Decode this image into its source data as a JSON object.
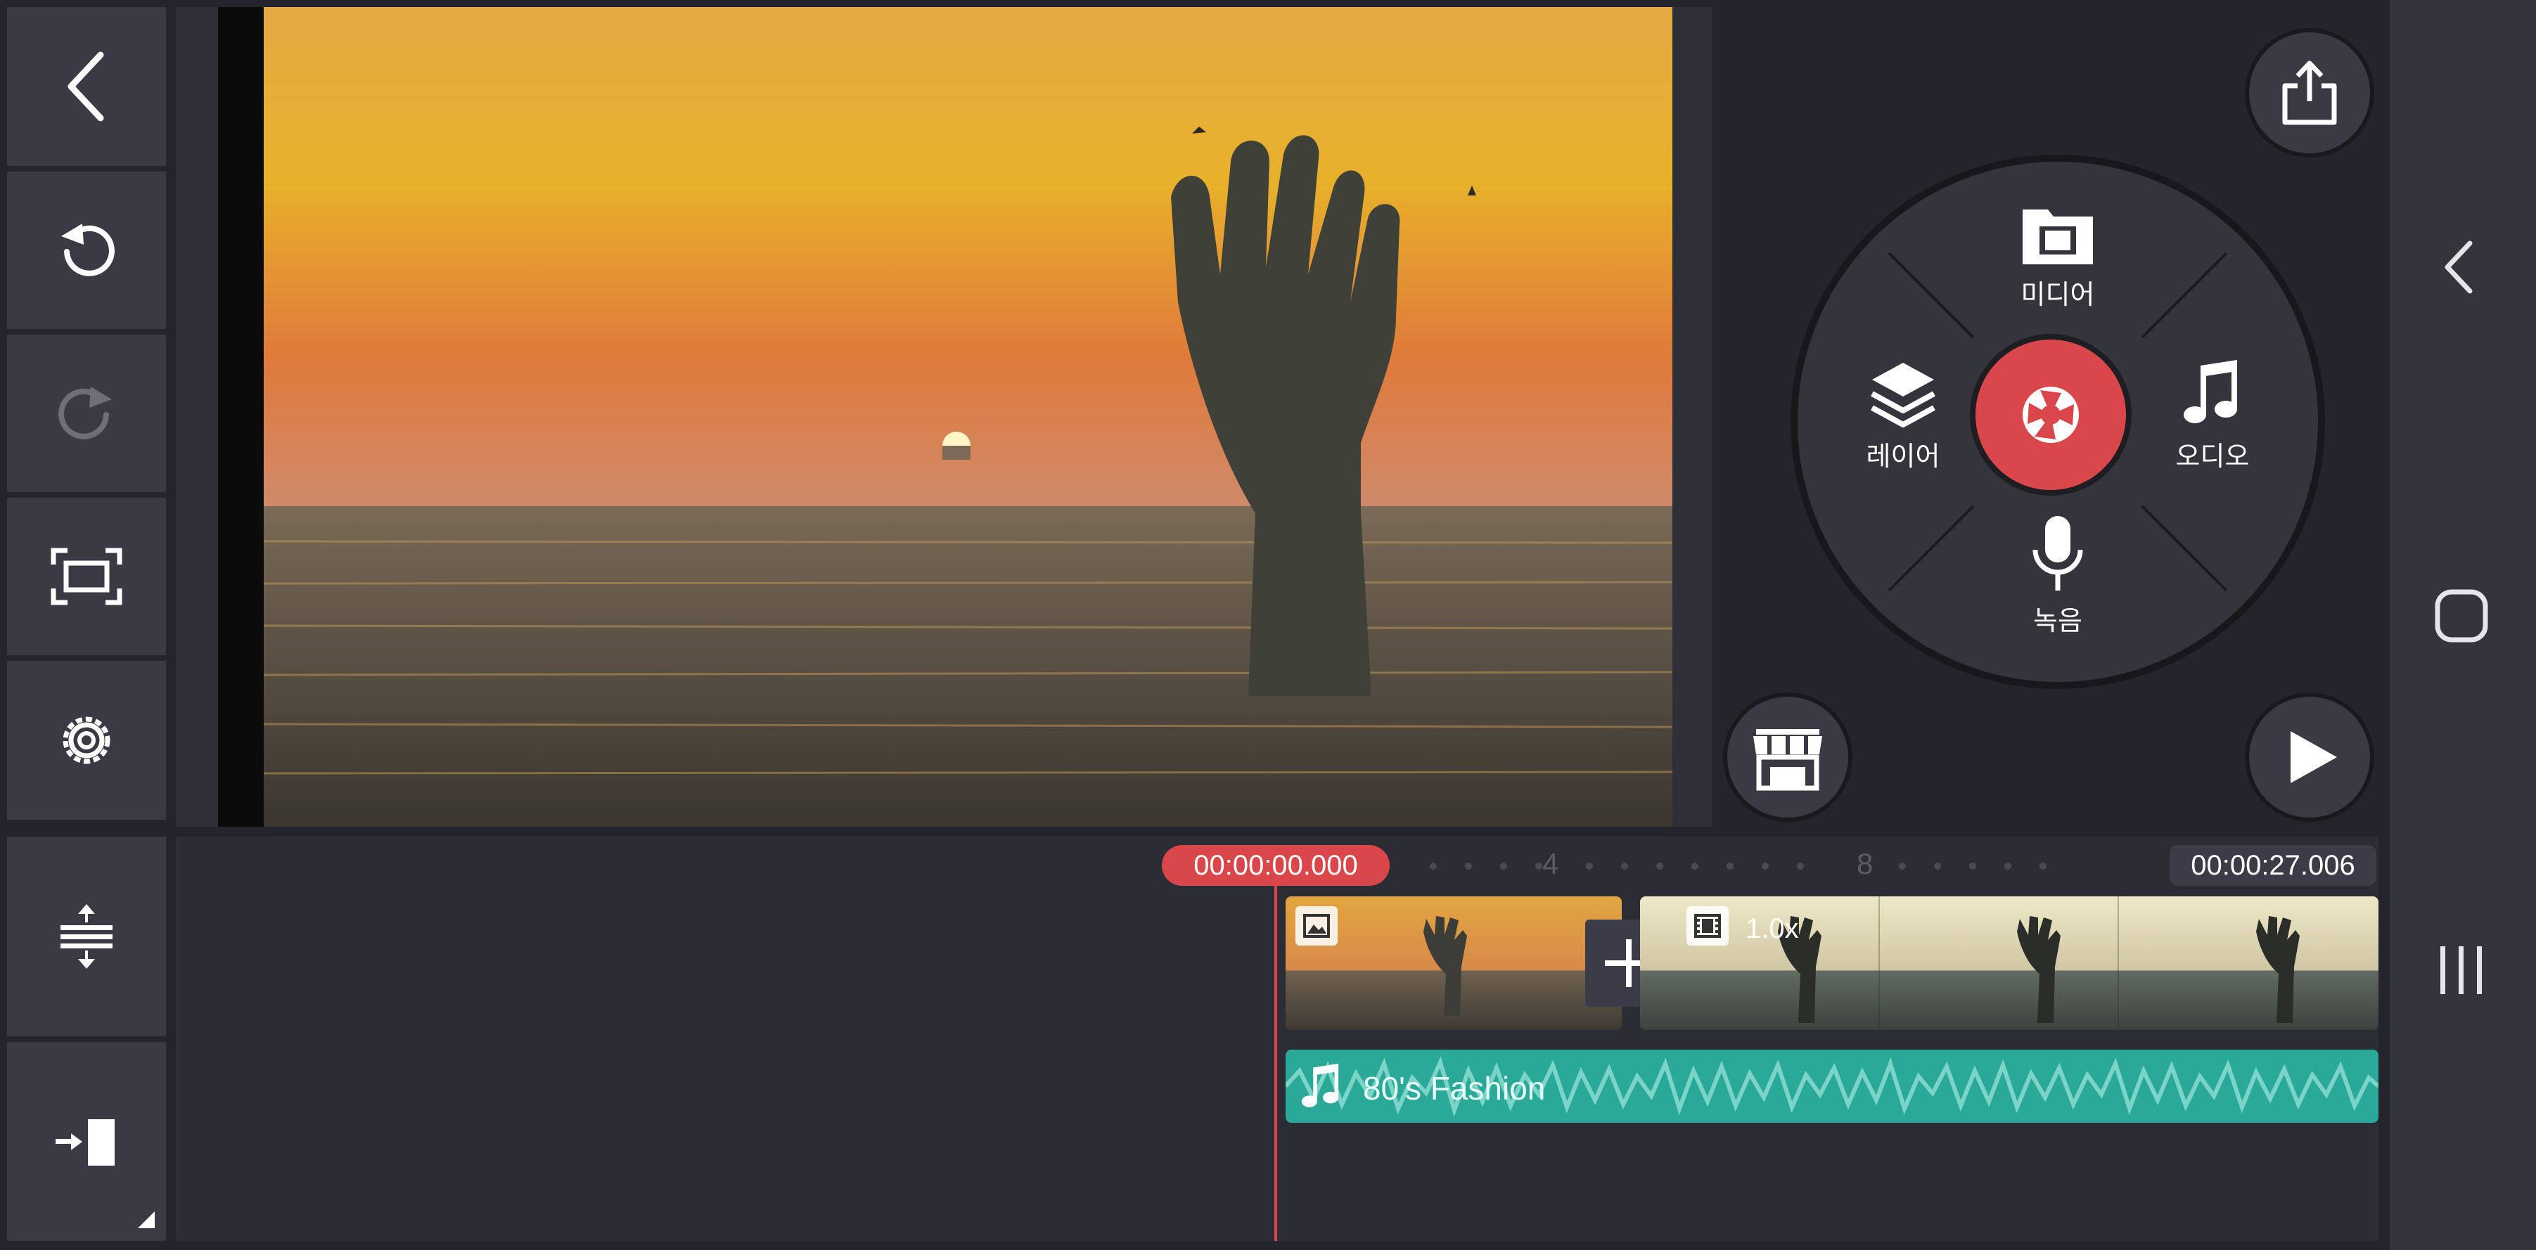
{
  "left_toolbar": {
    "icons": [
      "back-icon",
      "undo-icon",
      "redo-icon",
      "aspect-ratio-icon",
      "settings-icon"
    ]
  },
  "timeline_tools": {
    "icons": [
      "track-height-icon",
      "jump-to-end-icon"
    ]
  },
  "wheel": {
    "media_label": "미디어",
    "audio_label": "오디오",
    "record_label": "녹음",
    "layer_label": "레이어"
  },
  "timeline": {
    "current_time": "00:00:00.000",
    "total_time": "00:00:27.006",
    "ruler_labels": [
      "4",
      "8"
    ],
    "clip2_speed": "1.0x",
    "audio_track_title": "80's Fashion"
  },
  "colors": {
    "accent_red": "#d9474b",
    "audio_teal": "#2aa898",
    "panel": "#3a3a44",
    "background": "#24242c"
  }
}
